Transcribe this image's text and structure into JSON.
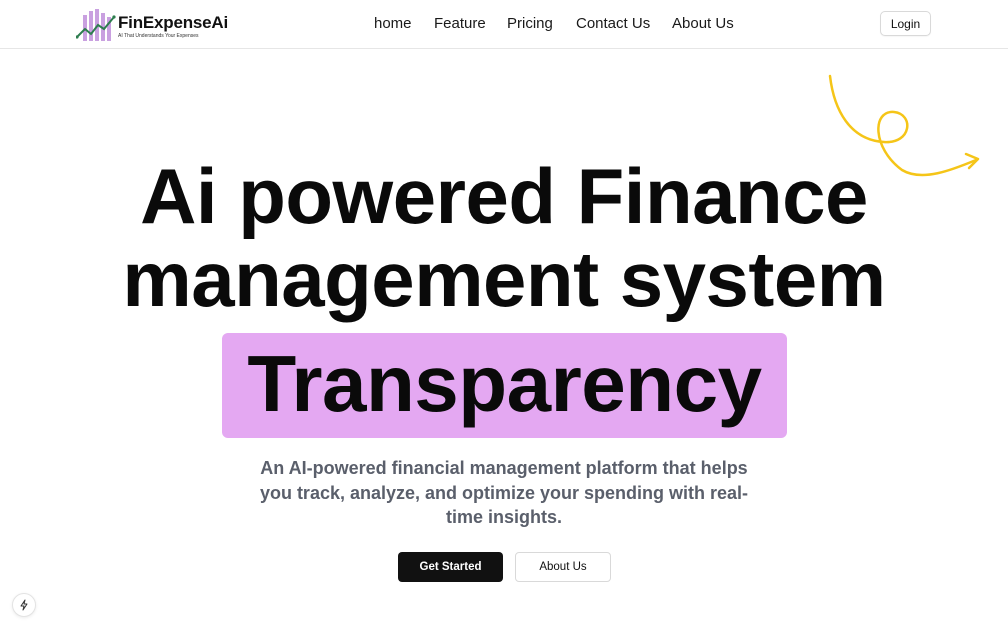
{
  "brand": {
    "name": "FinExpenseAi",
    "tagline": "AI That Understands Your Expenses",
    "colors": {
      "bars": "#c9a0e0",
      "trend_line": "#2e7d4f",
      "accent_highlight": "#e4a8f2",
      "squiggle": "#f5c518"
    }
  },
  "nav": {
    "items": [
      "home",
      "Feature",
      "Pricing",
      "Contact Us",
      "About Us"
    ],
    "login_label": "Login"
  },
  "hero": {
    "line1": "Ai powered Finance",
    "line2": "management system",
    "highlight": "Transparency",
    "subtitle": "An AI-powered financial management platform that helps you track, analyze, and optimize your spending with real-time insights.",
    "primary_cta": "Get Started",
    "secondary_cta": "About Us"
  },
  "icons": {
    "logo": "chart-bars-trend-icon",
    "decoration": "curly-arrow-icon",
    "dev_badge": "lightning-icon"
  }
}
